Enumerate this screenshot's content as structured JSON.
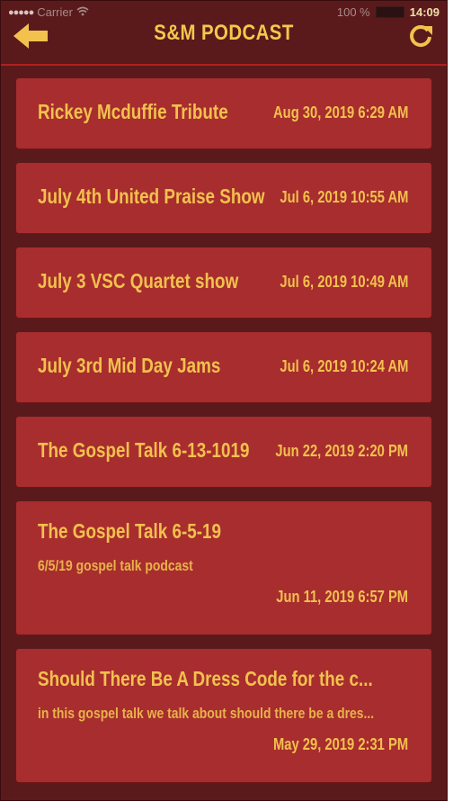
{
  "status_bar": {
    "carrier": "Carrier",
    "battery": "100 %",
    "time": "14:09"
  },
  "header": {
    "title": "S&M PODCAST"
  },
  "colors": {
    "background": "#5a1a1c",
    "card": "#a82d2e",
    "accent": "#f2c14e"
  },
  "icons": {
    "back": "arrow-left-icon",
    "refresh": "refresh-icon"
  },
  "episodes": [
    {
      "title": "Rickey Mcduffie Tribute",
      "date": "Aug 30, 2019 6:29 AM"
    },
    {
      "title": "July 4th United Praise Show",
      "date": "Jul 6, 2019 10:55 AM"
    },
    {
      "title": "July 3 VSC Quartet show",
      "date": "Jul 6, 2019 10:49 AM"
    },
    {
      "title": "July 3rd Mid Day Jams",
      "date": "Jul 6, 2019 10:24 AM"
    },
    {
      "title": "The Gospel Talk 6-13-1019",
      "date": "Jun 22, 2019 2:20 PM"
    },
    {
      "title": "The Gospel Talk 6-5-19",
      "description": "6/5/19 gospel talk podcast",
      "date": "Jun 11, 2019 6:57 PM"
    },
    {
      "title": "Should There Be A Dress Code for the c...",
      "description": "in this gospel talk we talk about should there be a dres...",
      "date": "May 29, 2019 2:31 PM"
    }
  ]
}
